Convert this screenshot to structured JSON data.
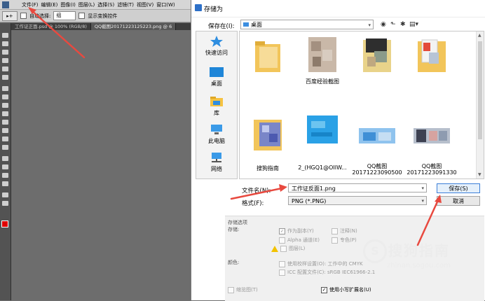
{
  "ps": {
    "menu": [
      "文件(F)",
      "编辑(E)",
      "图像(I)",
      "图层(L)",
      "选择(S)",
      "滤镜(T)",
      "视图(V)",
      "窗口(W)"
    ],
    "options": {
      "auto_select": "自动选择:",
      "group": "组",
      "show_transform": "显示变换控件"
    },
    "tabs": [
      "工作证正面.psd @ 100% (RGB/8)",
      "QQ截图20171223125223.png @ 6"
    ]
  },
  "dialog": {
    "title": "存储为",
    "save_in_label": "保存在(I):",
    "save_in_value": "桌面",
    "places": [
      {
        "label": "快速访问",
        "icon": "star-icon"
      },
      {
        "label": "桌面",
        "icon": "desktop-icon"
      },
      {
        "label": "库",
        "icon": "library-icon"
      },
      {
        "label": "此电脑",
        "icon": "computer-icon"
      },
      {
        "label": "网络",
        "icon": "network-icon"
      }
    ],
    "files": [
      {
        "name": "",
        "kind": "folder"
      },
      {
        "name": "百度经验截图",
        "kind": "folder-blur"
      },
      {
        "name": "",
        "kind": "folder-photo"
      },
      {
        "name": "",
        "kind": "folder-doc"
      },
      {
        "name": "搜狗指南",
        "kind": "folder-blue"
      },
      {
        "name": "2_(HGQ1@OIIW...",
        "kind": "image-blue"
      },
      {
        "name": "QQ截图\n20171223090500",
        "kind": "image-blur"
      },
      {
        "name": "QQ截图\n20171223091330",
        "kind": "image-blur2"
      }
    ],
    "filename_label": "文件名(N):",
    "filename_value": "工作证反面1.png",
    "format_label": "格式(F):",
    "format_value": "PNG (*.PNG)",
    "save_button": "保存(S)",
    "cancel_button": "取消",
    "options": {
      "header": "存储选项",
      "store_label": "存储:",
      "as_copy": "作为副本(Y)",
      "alpha": "Alpha 通道(E)",
      "layers": "图层(L)",
      "annotations": "注释(N)",
      "spot": "专色(P)",
      "color_label": "颜色:",
      "use_proof": "使用校样设置(O): 工作中的 CMYK",
      "icc": "ICC 配置文件(C): sRGB IEC61966-2.1",
      "thumbnail": "缩览图(T)",
      "lowercase_ext": "使用小写扩展名(U)"
    }
  },
  "watermark": {
    "symbol": "S",
    "title": "搜狗指南",
    "url": "zhinan.sogou.com"
  },
  "colors": {
    "arrow": "#e8493f",
    "ps_bg": "#6e6e6e",
    "accent": "#3c7fd8"
  }
}
